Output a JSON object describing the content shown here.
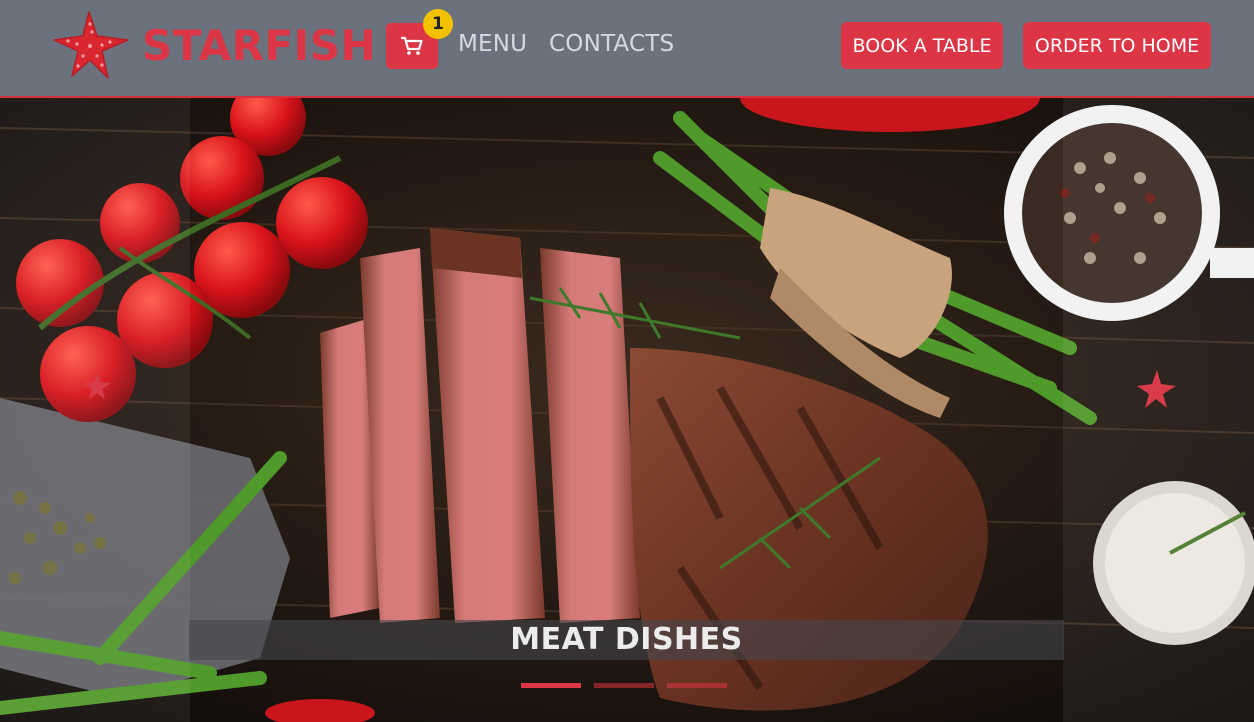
{
  "brand": {
    "name": "STARFISH",
    "logo_icon": "starfish-icon"
  },
  "cart": {
    "icon": "shopping-cart-icon",
    "count": "1"
  },
  "nav": {
    "menu_label": "MENU",
    "contacts_label": "CONTACTS"
  },
  "actions": {
    "book_label": "BOOK A TABLE",
    "order_label": "ORDER TO HOME"
  },
  "carousel": {
    "caption": "MEAT DISHES",
    "slide_count": 3,
    "active_slide": 1
  },
  "colors": {
    "accent": "#dc3545",
    "navbar_bg": "#6b727d",
    "badge": "#f2c200"
  }
}
